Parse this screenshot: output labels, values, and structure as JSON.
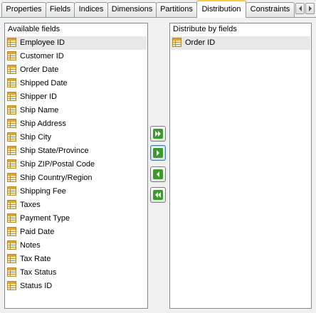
{
  "tabs": [
    {
      "label": "Properties",
      "active": false
    },
    {
      "label": "Fields",
      "active": false
    },
    {
      "label": "Indices",
      "active": false
    },
    {
      "label": "Dimensions",
      "active": false
    },
    {
      "label": "Partitions",
      "active": false
    },
    {
      "label": "Distribution",
      "active": true
    },
    {
      "label": "Constraints",
      "active": false
    }
  ],
  "available": {
    "header": "Available fields",
    "items": [
      "Employee ID",
      "Customer ID",
      "Order Date",
      "Shipped Date",
      "Shipper ID",
      "Ship Name",
      "Ship Address",
      "Ship City",
      "Ship State/Province",
      "Ship ZIP/Postal Code",
      "Ship Country/Region",
      "Shipping Fee",
      "Taxes",
      "Payment Type",
      "Paid Date",
      "Notes",
      "Tax Rate",
      "Tax Status",
      "Status ID"
    ]
  },
  "distribute": {
    "header": "Distribute by fields",
    "items": [
      "Order ID"
    ]
  },
  "buttons": {
    "add_all": "add-all",
    "add": "add",
    "remove": "remove",
    "remove_all": "remove-all"
  },
  "colors": {
    "accent_green": "#3a9a2a",
    "tab_highlight": "#ffc83c",
    "selection": "#e8e8e8"
  }
}
